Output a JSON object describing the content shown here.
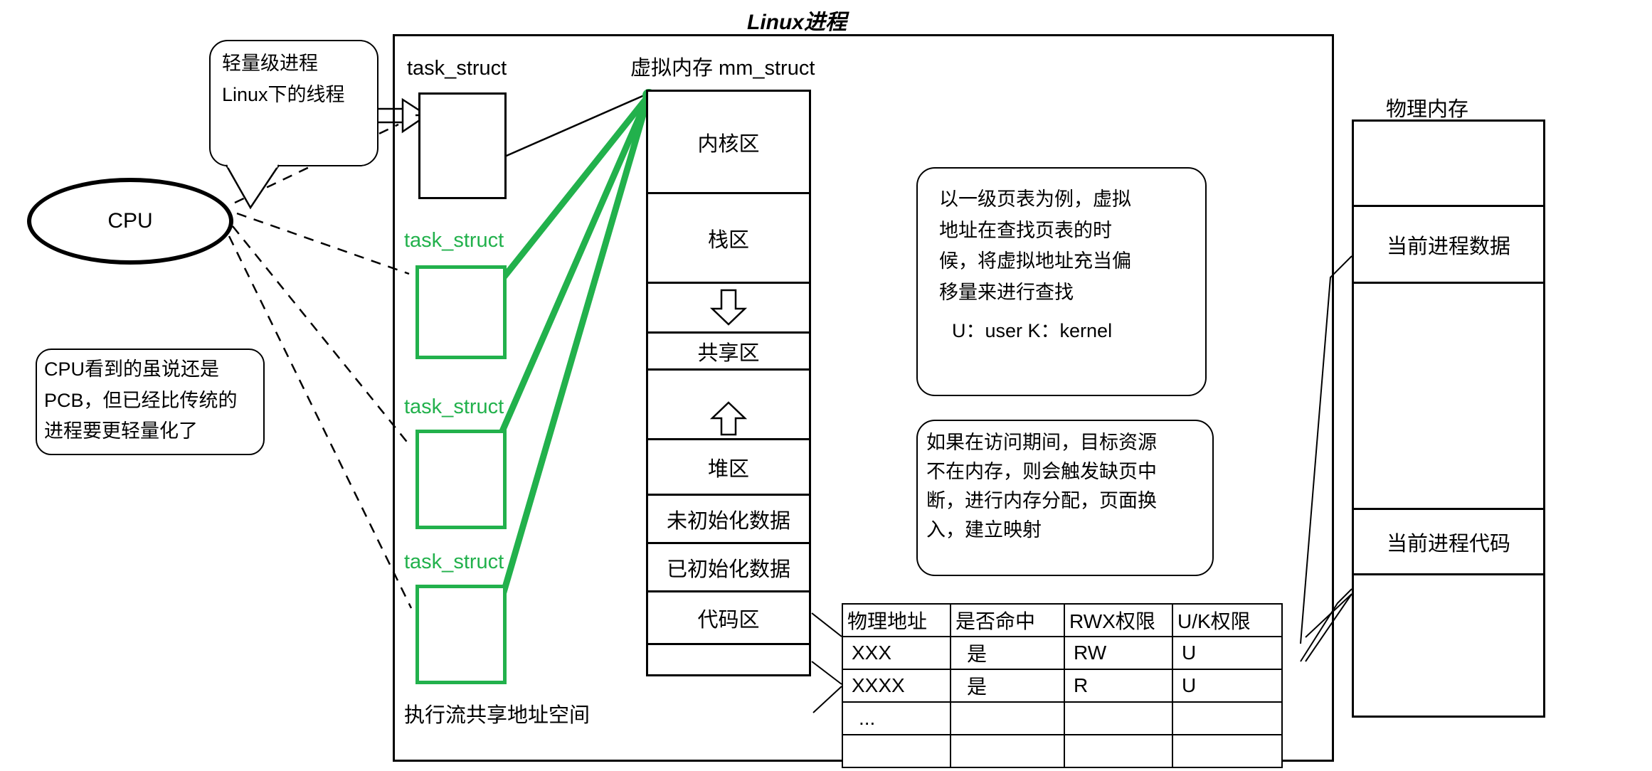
{
  "title": "Linux进程",
  "callouts": {
    "thread": {
      "lines": [
        "轻量级进程",
        "Linux下的线程"
      ]
    },
    "pcb": {
      "lines": [
        "CPU看到的虽说还是",
        "PCB，但已经比传统的",
        "进程要更轻量化了"
      ]
    },
    "page_table_note": {
      "lines": [
        "以一级页表为例，虚拟",
        "地址在查找页表的时",
        "候，将虚拟地址充当偏",
        "移量来进行查找",
        "",
        "U：user  K：kernel"
      ]
    },
    "page_fault_note": {
      "lines": [
        "如果在访问期间，目标资源",
        "不在内存，则会触发缺页中",
        "断，进行内存分配，页面换",
        "入，建立映射"
      ]
    }
  },
  "cpu": {
    "label": "CPU"
  },
  "task_structs": {
    "primary_label": "task_struct",
    "thread_labels": [
      "task_struct",
      "task_struct",
      "task_struct"
    ],
    "footer": "执行流共享地址空间"
  },
  "virtual_memory": {
    "header": "虚拟内存 mm_struct",
    "segments": [
      {
        "label": "内核区",
        "kind": "text"
      },
      {
        "label": "栈区",
        "kind": "text"
      },
      {
        "label": "",
        "kind": "arrow-down"
      },
      {
        "label": "共享区",
        "kind": "text"
      },
      {
        "label": "",
        "kind": "arrow-up"
      },
      {
        "label": "堆区",
        "kind": "text"
      },
      {
        "label": "未初始化数据",
        "kind": "text"
      },
      {
        "label": "已初始化数据",
        "kind": "text"
      },
      {
        "label": "代码区",
        "kind": "text"
      }
    ]
  },
  "physical_memory": {
    "header": "物理内存",
    "segments": [
      {
        "label": ""
      },
      {
        "label": "当前进程数据"
      },
      {
        "label": ""
      },
      {
        "label": "当前进程代码"
      },
      {
        "label": ""
      }
    ]
  },
  "page_table": {
    "headers": [
      "物理地址",
      "是否命中",
      "RWX权限",
      "U/K权限"
    ],
    "rows": [
      [
        "XXX",
        "是",
        "RW",
        "U"
      ],
      [
        "XXXX",
        "是",
        "R",
        "U"
      ],
      [
        "...",
        "",
        "",
        ""
      ],
      [
        "",
        "",
        "",
        ""
      ]
    ]
  },
  "colors": {
    "green": "#22b14c",
    "black": "#000000"
  }
}
